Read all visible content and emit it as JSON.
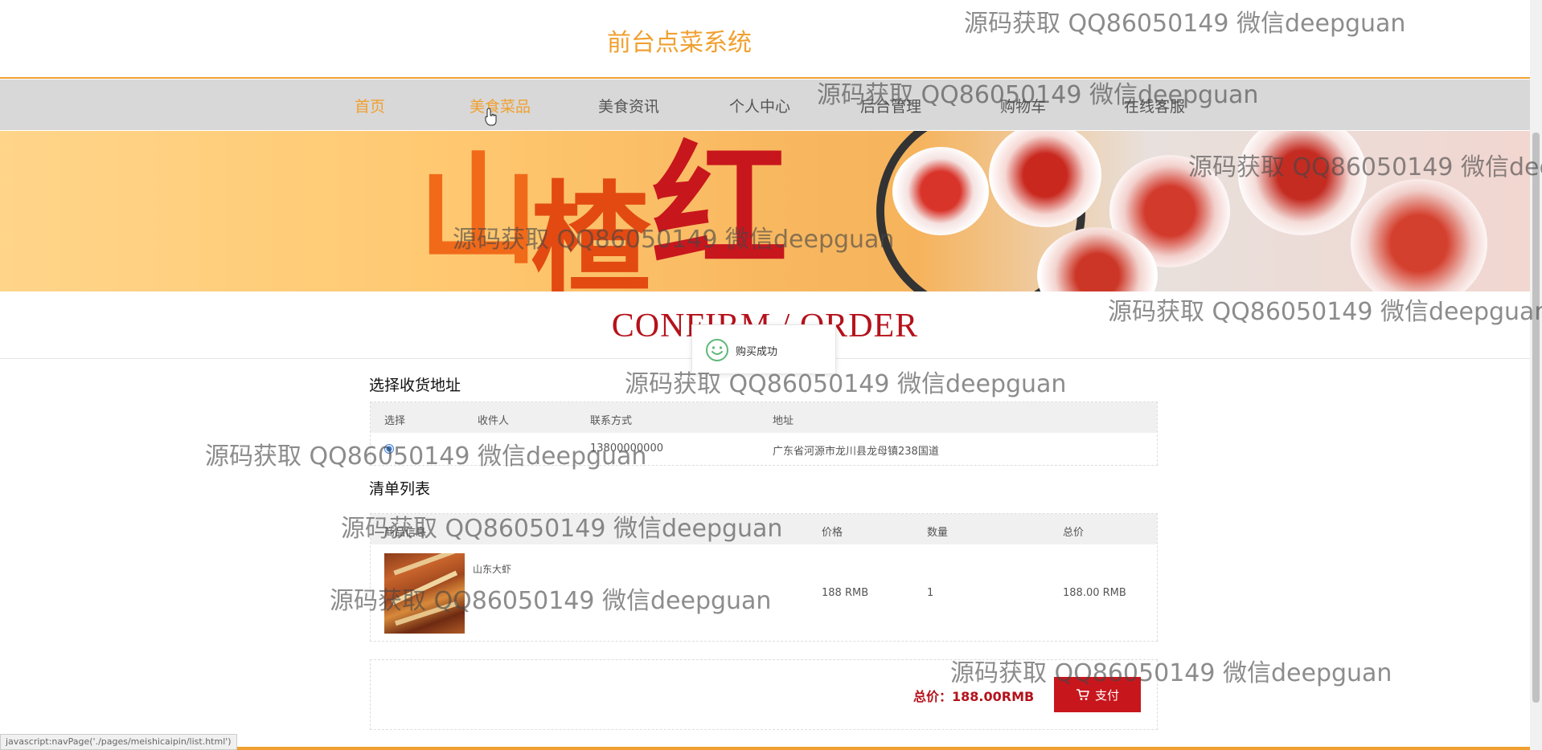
{
  "header": {
    "title": "前台点菜系统"
  },
  "nav": {
    "items": [
      {
        "label": "首页"
      },
      {
        "label": "美食菜品"
      },
      {
        "label": "美食资讯"
      },
      {
        "label": "个人中心"
      },
      {
        "label": "后台管理"
      },
      {
        "label": "购物车"
      },
      {
        "label": "在线客服"
      }
    ]
  },
  "banner": {
    "chars": [
      "山",
      "楂",
      "红"
    ]
  },
  "confirm": {
    "title": "CONFIRM / ORDER"
  },
  "toast": {
    "text": "购买成功"
  },
  "address": {
    "section_title": "选择收货地址",
    "headers": [
      "选择",
      "收件人",
      "联系方式",
      "地址"
    ],
    "rows": [
      {
        "recipient": "",
        "phone": "13800000000",
        "address": "广东省河源市龙川县龙母镇238国道"
      }
    ]
  },
  "order": {
    "section_title": "清单列表",
    "headers": [
      "商品信息",
      "价格",
      "数量",
      "总价"
    ],
    "items": [
      {
        "name": "山东大虾",
        "price": "188 RMB",
        "quantity": "1",
        "total": "188.00 RMB"
      }
    ]
  },
  "summary": {
    "total_label": "总价：188.00RMB",
    "pay_label": "支付"
  },
  "status_bar": {
    "text": "javascript:navPage('./pages/meishicaipin/list.html')"
  },
  "watermark": {
    "text": "源码获取 QQ86050149 微信deepguan"
  },
  "colors": {
    "accent": "#f0a030",
    "brand_red": "#c8161d",
    "nav_bg": "#d8d8d8"
  }
}
